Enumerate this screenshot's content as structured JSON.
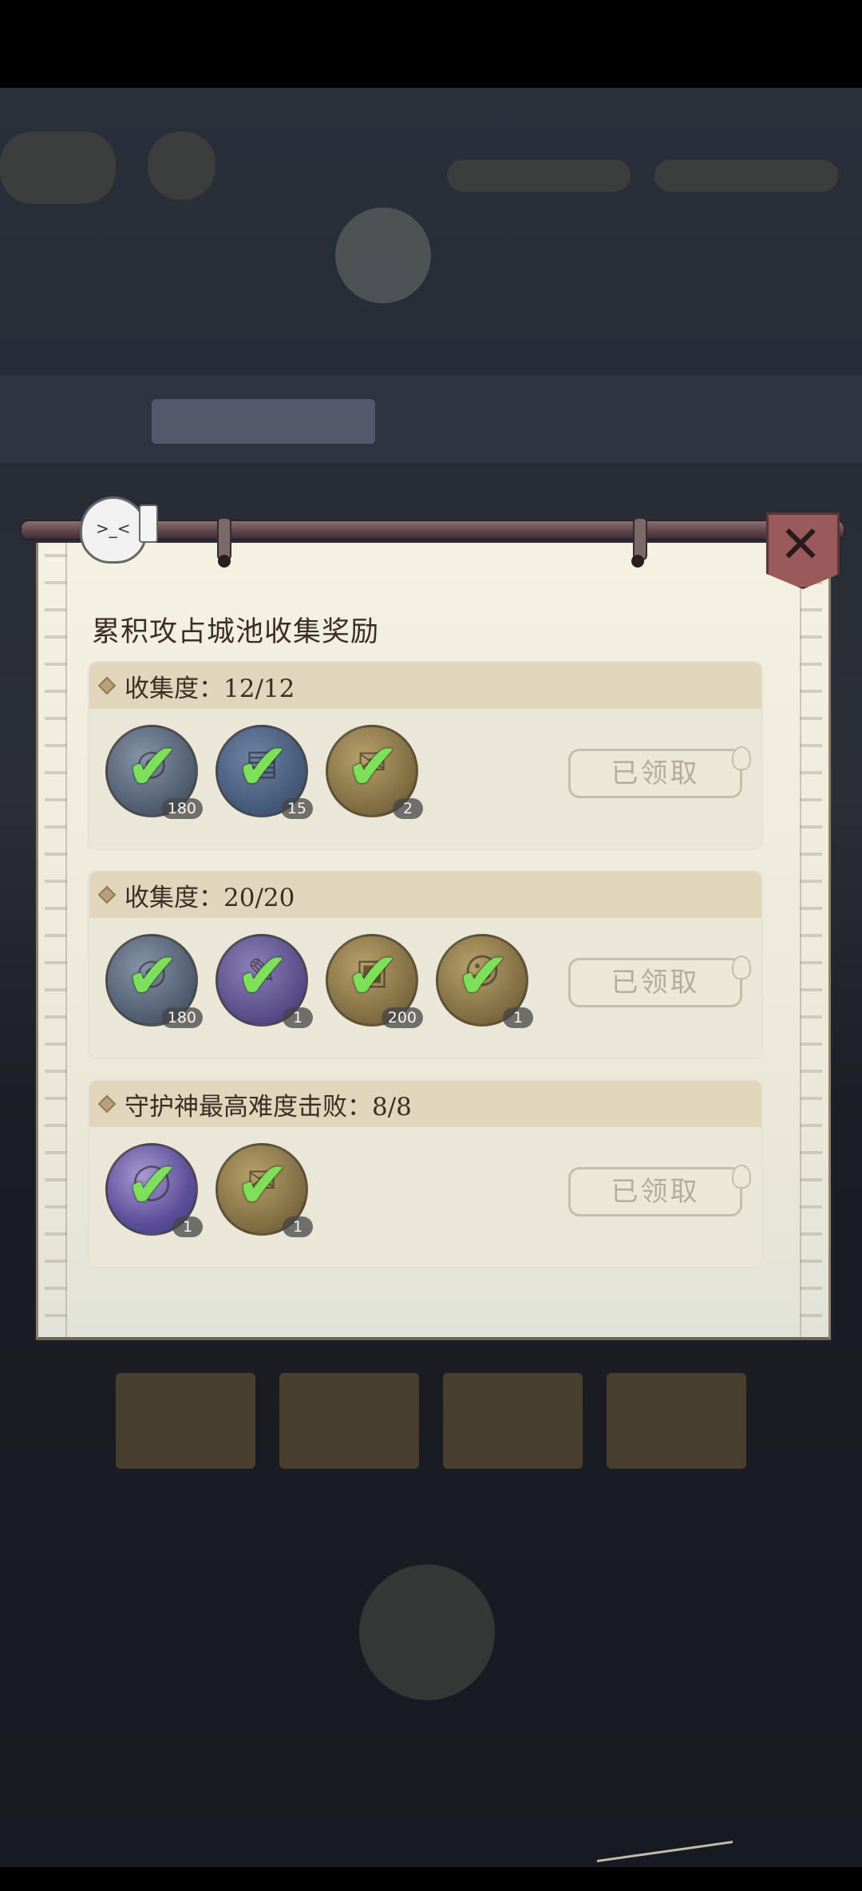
{
  "panel": {
    "title": "累积攻占城池收集奖励",
    "close_icon": "✕"
  },
  "sections": [
    {
      "header": "收集度：12/12",
      "rewards": [
        {
          "icon": "coin-icon",
          "glyph": "◎",
          "qty": "180",
          "color": "steel",
          "claimed": true
        },
        {
          "icon": "book-icon",
          "glyph": "▤",
          "qty": "15",
          "color": "blue",
          "claimed": true
        },
        {
          "icon": "token-icon",
          "glyph": "✉",
          "qty": "2",
          "color": "gold",
          "claimed": true
        }
      ],
      "button_label": "已领取"
    },
    {
      "header": "收集度：20/20",
      "rewards": [
        {
          "icon": "coin-icon",
          "glyph": "◎",
          "qty": "180",
          "color": "steel",
          "claimed": true
        },
        {
          "icon": "scroll-icon",
          "glyph": "✎",
          "qty": "1",
          "color": "purple",
          "claimed": true
        },
        {
          "icon": "chest-icon",
          "glyph": "▣",
          "qty": "200",
          "color": "gold",
          "claimed": true
        },
        {
          "icon": "portrait-icon",
          "glyph": "☺",
          "qty": "1",
          "color": "gold",
          "claimed": true
        }
      ],
      "button_label": "已领取"
    },
    {
      "header": "守护神最高难度击败：8/8",
      "rewards": [
        {
          "icon": "ring-icon",
          "glyph": "◯",
          "qty": "1",
          "color": "ring",
          "claimed": true
        },
        {
          "icon": "token-icon",
          "glyph": "✉",
          "qty": "1",
          "color": "gold",
          "claimed": true
        }
      ],
      "button_label": "已领取"
    }
  ],
  "check_glyph": "✔",
  "colors": {
    "check": "#7ee05a",
    "header_band": "#e1d5bb",
    "paper": "#f4f0e2",
    "close_plate": "#9a5a5c"
  }
}
